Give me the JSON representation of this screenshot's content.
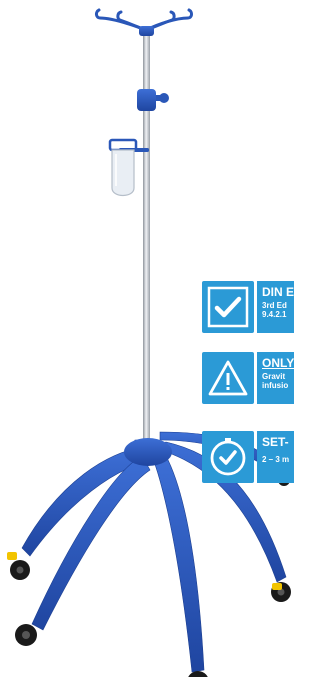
{
  "product": {
    "icons": [
      "iv-hook-icon",
      "height-clamp-icon",
      "drip-bottle-holder-icon",
      "caster-wheel-icon"
    ],
    "colors": {
      "plastic": "#2a57b8",
      "pole": "#c7ccd3",
      "badge": "#2b9ad6"
    }
  },
  "badges": [
    {
      "icon": "checkmark-icon",
      "title": "DIN E",
      "line1": "3rd Ed",
      "line2": "9.4.2.1"
    },
    {
      "icon": "warning-icon",
      "title": "ONLY",
      "line1": "Gravit",
      "line2": "infusio"
    },
    {
      "icon": "clock-icon",
      "title": "SET-",
      "line1": "2 – 3 m",
      "line2": ""
    }
  ]
}
